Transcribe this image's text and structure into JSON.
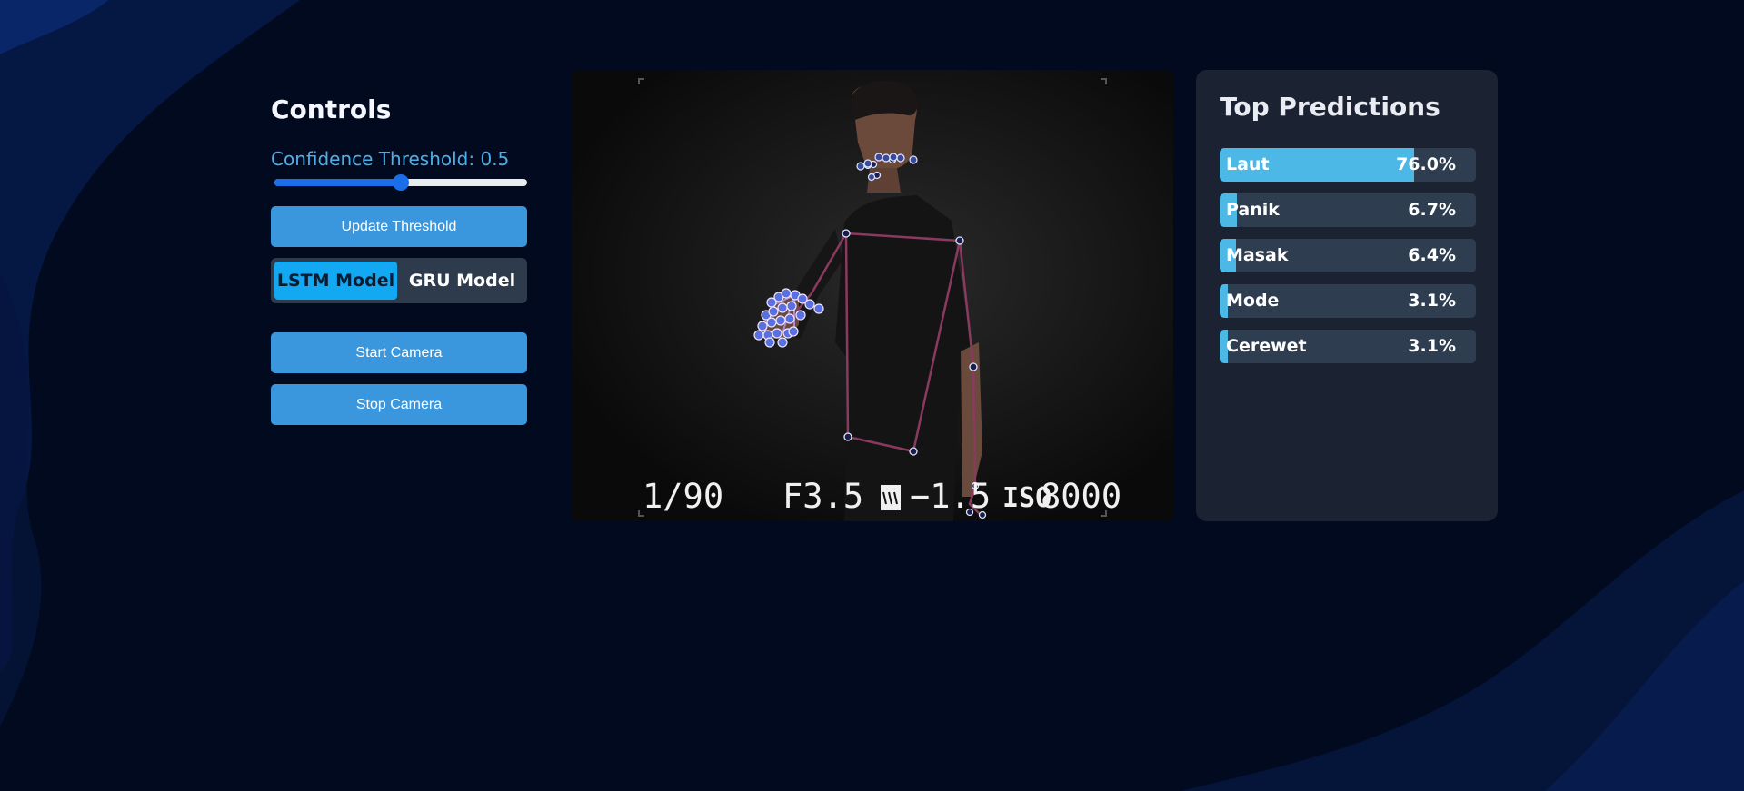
{
  "controls": {
    "title": "Controls",
    "threshold_label_prefix": "Confidence Threshold: ",
    "threshold_value": 0.5,
    "update_button": "Update Threshold",
    "models": [
      {
        "label": "LSTM Model",
        "active": true
      },
      {
        "label": "GRU Model",
        "active": false
      }
    ],
    "start_button": "Start Camera",
    "stop_button": "Stop Camera"
  },
  "camera": {
    "osd": {
      "shutter": "1/90",
      "aperture": "F3.5",
      "exposure": "−1.5",
      "iso_label": "ISO",
      "iso_value": "8000"
    }
  },
  "predictions": {
    "title": "Top Predictions",
    "items": [
      {
        "label": "Laut",
        "value": 76.0,
        "text": "76.0%"
      },
      {
        "label": "Panik",
        "value": 6.7,
        "text": "6.7%"
      },
      {
        "label": "Masak",
        "value": 6.4,
        "text": "6.4%"
      },
      {
        "label": "Mode",
        "value": 3.1,
        "text": "3.1%"
      },
      {
        "label": "Cerewet",
        "value": 3.1,
        "text": "3.1%"
      }
    ]
  },
  "colors": {
    "background": "#020a1f",
    "button": "#3a97dd",
    "accent": "#4faee8",
    "active_model": "#13a9f2",
    "prediction_fill": "#4cb8e6",
    "panel": "#1b2333",
    "pose_line": "#8a3a5f"
  }
}
